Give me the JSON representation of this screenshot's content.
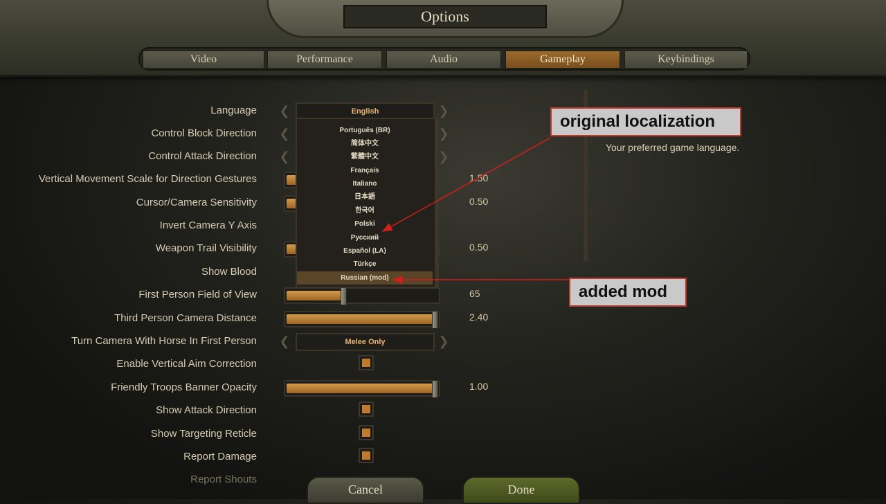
{
  "header": {
    "title": "Options",
    "tabs": [
      {
        "label": "Video",
        "active": false
      },
      {
        "label": "Performance",
        "active": false
      },
      {
        "label": "Audio",
        "active": false
      },
      {
        "label": "Gameplay",
        "active": true
      },
      {
        "label": "Keybindings",
        "active": false
      }
    ]
  },
  "settings": {
    "language": {
      "label": "Language",
      "value": "English"
    },
    "control_block_direction": {
      "label": "Control Block Direction"
    },
    "control_attack_direction": {
      "label": "Control Attack Direction"
    },
    "vertical_movement_scale": {
      "label": "Vertical Movement Scale for Direction Gestures",
      "value": "1.50"
    },
    "cursor_camera_sensitivity": {
      "label": "Cursor/Camera Sensitivity",
      "value": "0.50"
    },
    "invert_camera_y": {
      "label": "Invert Camera Y Axis"
    },
    "weapon_trail_visibility": {
      "label": "Weapon Trail Visibility",
      "value": "0.50"
    },
    "show_blood": {
      "label": "Show Blood"
    },
    "first_person_fov": {
      "label": "First Person Field of View",
      "value": "65",
      "fill": 0.37
    },
    "third_person_camera_distance": {
      "label": "Third Person Camera Distance",
      "value": "2.40",
      "fill": 1.0
    },
    "turn_camera_with_horse": {
      "label": "Turn Camera With Horse In First Person",
      "value": "Melee Only"
    },
    "vertical_aim_correction": {
      "label": "Enable Vertical Aim Correction",
      "checked": true
    },
    "friendly_banner_opacity": {
      "label": "Friendly Troops Banner Opacity",
      "value": "1.00",
      "fill": 1.0
    },
    "show_attack_direction": {
      "label": "Show Attack Direction",
      "checked": true
    },
    "show_targeting_reticle": {
      "label": "Show Targeting Reticle",
      "checked": true
    },
    "report_damage": {
      "label": "Report Damage",
      "checked": true
    },
    "report_shouts": {
      "label": "Report Shouts"
    }
  },
  "language_list": [
    "Português (BR)",
    "简体中文",
    "繁體中文",
    "Français",
    "Italiano",
    "日本語",
    "한국어",
    "Polski",
    "Русский",
    "Español (LA)",
    "Türkçe",
    "Russian (mod)"
  ],
  "description": "Your preferred game language.",
  "annotations": {
    "original": "original localization",
    "added": "added mod"
  },
  "footer": {
    "cancel": "Cancel",
    "done": "Done"
  },
  "colors": {
    "accent_orange": "#c07a2e",
    "annotation_red": "#c0392b"
  }
}
